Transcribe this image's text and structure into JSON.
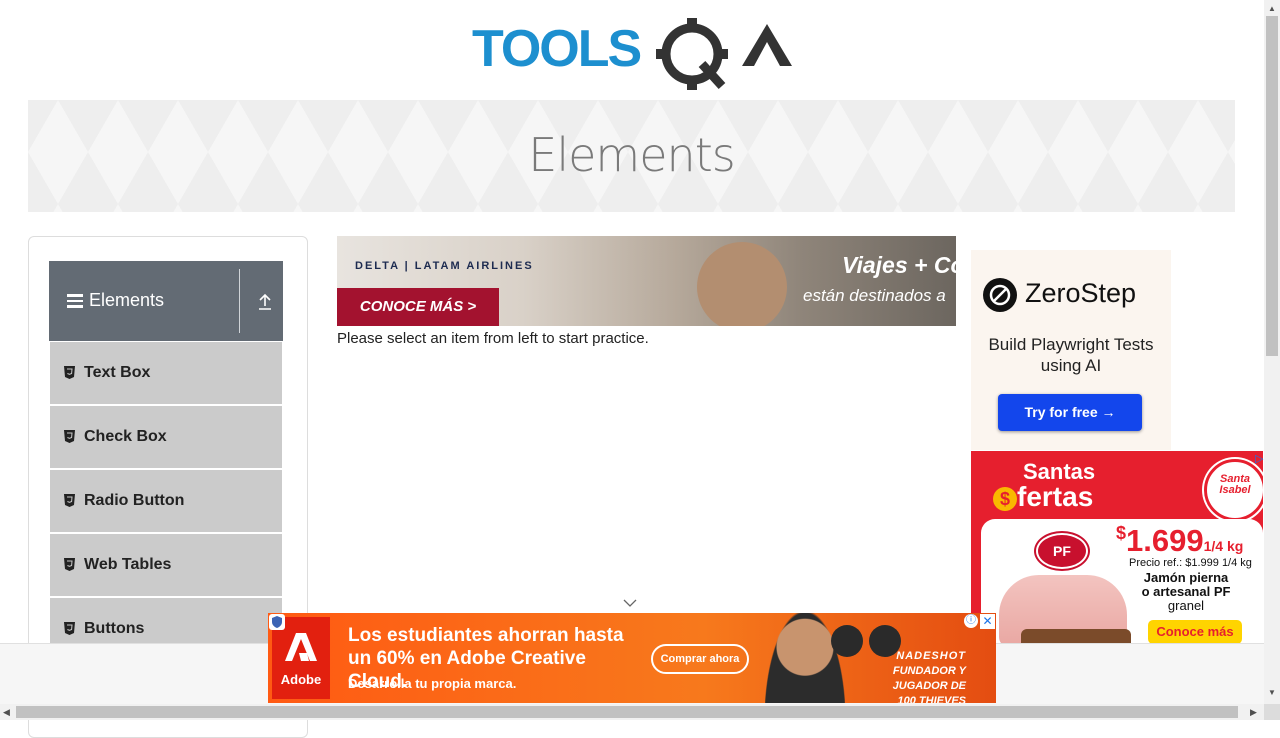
{
  "logo": {
    "alt": "TOOLSQA",
    "colors": {
      "tools": "#1d8fcf",
      "qa": "#333333"
    }
  },
  "page_title": "Elements",
  "sidebar": {
    "group": {
      "title": "Elements",
      "icon": "hamburger-icon",
      "toggle_icon": "upload-icon"
    },
    "items": [
      {
        "label": "Text Box",
        "icon": "html5-icon"
      },
      {
        "label": "Check Box",
        "icon": "html5-icon"
      },
      {
        "label": "Radio Button",
        "icon": "html5-icon"
      },
      {
        "label": "Web Tables",
        "icon": "html5-icon"
      },
      {
        "label": "Buttons",
        "icon": "html5-icon"
      }
    ]
  },
  "main": {
    "prompt": "Please select an item from left to start practice."
  },
  "ads": {
    "delta": {
      "brand": "DELTA | LATAM AIRLINES",
      "cta": "CONOCE MÁS >",
      "headline": "Viajes + Co",
      "sub": "están destinados a"
    },
    "zerostep": {
      "name": "ZeroStep",
      "tagline": "Build Playwright Tests using AI",
      "cta": "Try for free →"
    },
    "santa_isabel": {
      "title1": "Santas",
      "title2": "fertas",
      "badge": "Santa Isabel",
      "pf": "PF",
      "price_currency": "$",
      "price": "1.699",
      "price_unit": "1/4 kg",
      "ref": "Precio ref.: $1.999 1/4 kg",
      "product_line1": "Jamón pierna",
      "product_line2": "o artesanal PF",
      "product_line3": "granel",
      "cta": "Conoce más"
    },
    "adobe": {
      "brand": "Adobe",
      "headline": "Los estudiantes ahorran hasta un 60% en Adobe Creative Cloud.",
      "sub": "Desarrolla tu propia marca.",
      "cta": "Comprar ahora",
      "partner_name": "NADESHOT",
      "partner_role": "FUNDADOR Y JUGADOR DE 100 THIEVES"
    }
  }
}
